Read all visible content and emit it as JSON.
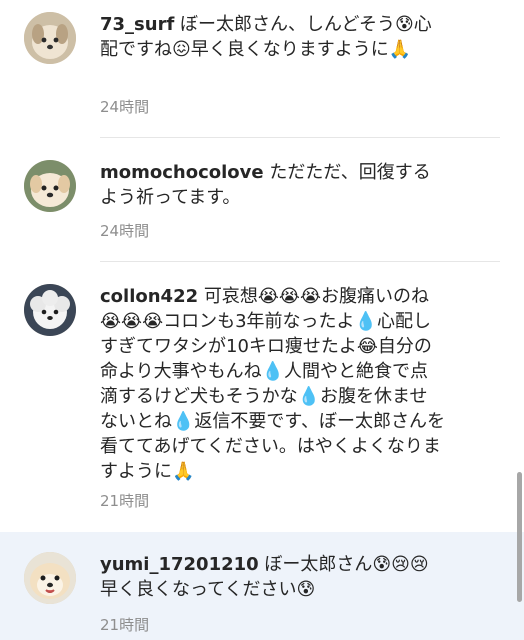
{
  "comments": [
    {
      "username": "73_surf",
      "text": "ぼー太郎さん、しんどそう😰心配ですね😖早く良くなりますように🙏",
      "time": "24時間"
    },
    {
      "username": "momochocolove",
      "text": "ただただ、回復するよう祈ってます。",
      "time": "24時間"
    },
    {
      "username": "collon422",
      "text": "可哀想😭😭😭お腹痛いのね😭😭😭コロンも3年前なったよ💧心配しすぎてワタシが10キロ痩せたよ😂自分の命より大事やもんね💧人間やと絶食で点滴するけど犬もそうかな💧お腹を休ませないとね💧返信不要です、ぼー太郎さんを看ててあげてください。はやくよくなりますように🙏",
      "time": "21時間"
    },
    {
      "username": "yumi_17201210",
      "text": "ぼー太郎さん😰😢😢早く良くなってください😰",
      "time": "21時間"
    }
  ]
}
